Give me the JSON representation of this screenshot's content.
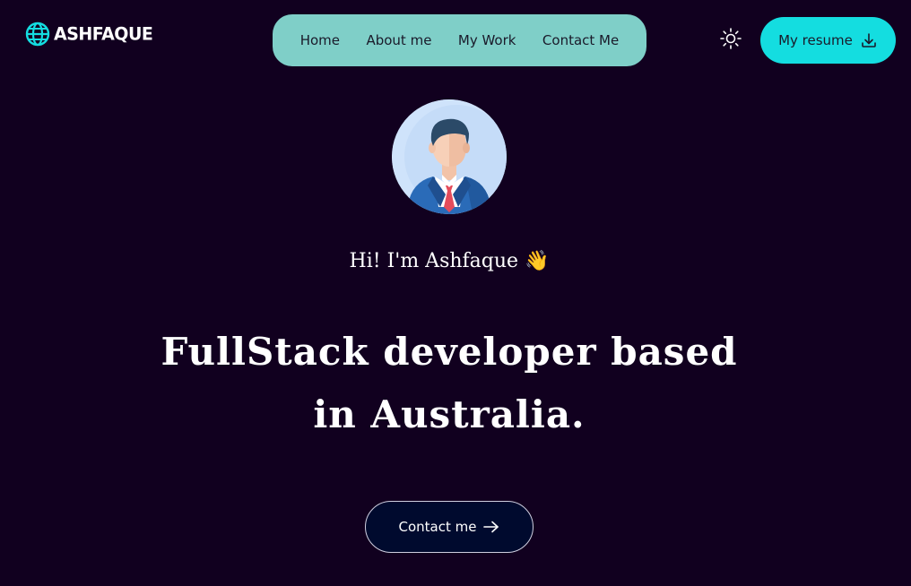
{
  "brand": {
    "name": "ASHFAQUE",
    "icon": "globe-icon"
  },
  "nav": {
    "items": [
      {
        "label": "Home"
      },
      {
        "label": "About me"
      },
      {
        "label": "My Work"
      },
      {
        "label": "Contact Me"
      }
    ],
    "background": "#7fcfc8"
  },
  "theme_toggle": {
    "icon": "sun-icon"
  },
  "resume_button": {
    "label": "My resume",
    "icon": "download-icon",
    "color": "#14dde0"
  },
  "hero": {
    "avatar": "avatar-illustration",
    "greeting": "Hi! I'm Ashfaque",
    "greeting_emoji": "👋",
    "headline": "FullStack developer based in Australia."
  },
  "contact_button": {
    "label": "Contact me",
    "icon": "arrow-right-icon"
  },
  "colors": {
    "page_background": "#11001f",
    "accent": "#14dde0"
  }
}
